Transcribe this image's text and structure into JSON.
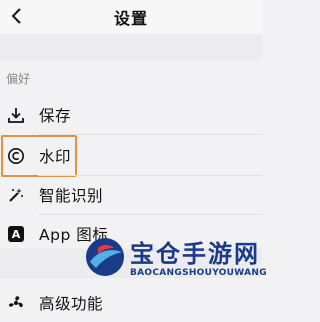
{
  "header": {
    "title": "设置",
    "back_icon": "chevron-left-icon"
  },
  "preferences": {
    "section_title": "偏好",
    "items": [
      {
        "label": "保存",
        "icon": "download-icon"
      },
      {
        "label": "水印",
        "icon": "copyright-icon"
      },
      {
        "label": "智能识别",
        "icon": "magic-wand-icon"
      },
      {
        "label": "App 图标",
        "icon": "app-letter-a-icon",
        "badge": "A"
      }
    ]
  },
  "advanced": {
    "label": "高级功能",
    "icon": "fan-icon"
  },
  "watermark": {
    "title": "宝仓手游网",
    "subtitle": "BAOCANGSHOUYOUWANG"
  },
  "colors": {
    "highlight": "#e8903a",
    "watermark_blue": "#1a3a8a"
  }
}
